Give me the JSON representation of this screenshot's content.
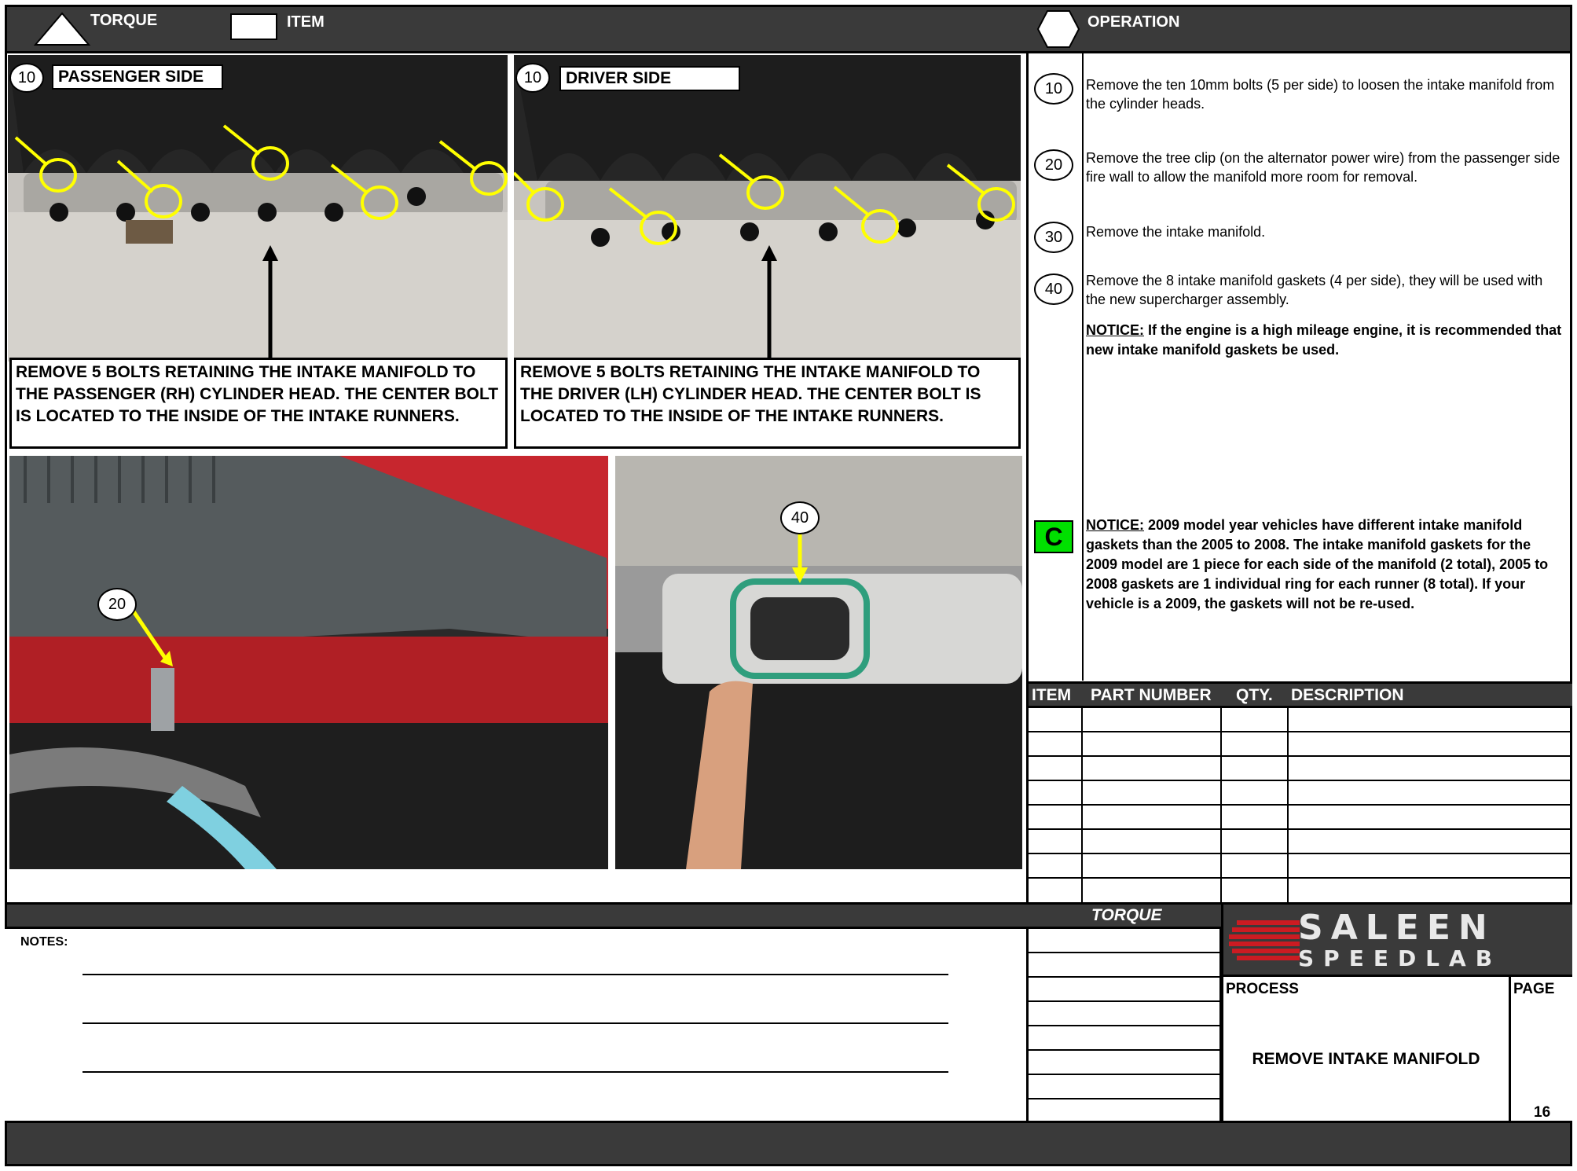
{
  "header": {
    "torque_label": "TORQUE",
    "item_label": "ITEM",
    "operation_label": "OPERATION"
  },
  "photos": {
    "passenger": {
      "step": "10",
      "side_label": "PASSENGER SIDE",
      "caption": "REMOVE 5 BOLTS RETAINING THE INTAKE MANIFOLD TO THE PASSENGER (RH) CYLINDER HEAD.  THE CENTER BOLT IS LOCATED TO THE INSIDE OF THE INTAKE RUNNERS."
    },
    "driver": {
      "step": "10",
      "side_label": "DRIVER SIDE",
      "caption": "REMOVE 5 BOLTS RETAINING THE INTAKE MANIFOLD TO THE DRIVER (LH) CYLINDER HEAD.  THE CENTER BOLT IS LOCATED TO THE INSIDE OF THE INTAKE RUNNERS."
    },
    "firewall": {
      "step": "20"
    },
    "gasket": {
      "step": "40"
    }
  },
  "operations": [
    {
      "step": "10",
      "text": "Remove the ten 10mm bolts (5 per side) to loosen the intake manifold from the cylinder heads."
    },
    {
      "step": "20",
      "text": "Remove the tree clip (on the alternator power wire) from the passenger side fire wall to allow the manifold more room for removal."
    },
    {
      "step": "30",
      "text": "Remove the intake manifold."
    },
    {
      "step": "40",
      "text": "Remove the 8 intake manifold gaskets (4 per side), they will be used with the new supercharger assembly."
    }
  ],
  "notice1": {
    "label": "NOTICE:",
    "text": "  If the engine is a high mileage engine, it is recommended that new intake manifold gaskets be used."
  },
  "notice2": {
    "badge": "C",
    "label": "NOTICE:",
    "text": "  2009 model year vehicles have different intake manifold gaskets than the 2005 to 2008.  The intake manifold gaskets for the 2009 model are 1 piece for each side of the manifold (2 total), 2005 to 2008 gaskets are 1 individual ring for each runner (8 total).  If your vehicle is a 2009, the gaskets will not be re-used."
  },
  "parts_table": {
    "headers": [
      "ITEM",
      "PART NUMBER",
      "QTY.",
      "DESCRIPTION"
    ],
    "rows": 8
  },
  "footer": {
    "torque_label": "TORQUE",
    "notes_label": "NOTES:",
    "logo_top": "SALEEN",
    "logo_bottom": "SPEEDLAB",
    "process_label": "PROCESS",
    "process_value": "REMOVE INTAKE MANIFOLD",
    "page_label": "PAGE",
    "page_value": "16"
  },
  "colors": {
    "bar": "#3a3a3a",
    "highlight_yellow": "#ffff00",
    "badge_green": "#00e000",
    "logo_red": "#cc1b22"
  }
}
